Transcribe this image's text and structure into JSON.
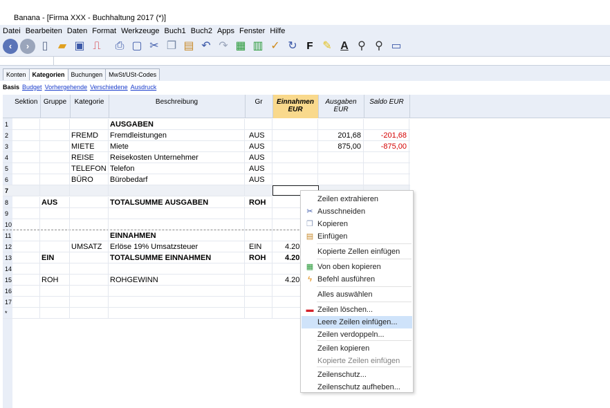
{
  "window": {
    "title": "Banana - [Firma XXX - Buchhaltung 2017 (*)]",
    "icon_text": "9"
  },
  "menu": [
    "Datei",
    "Bearbeiten",
    "Daten",
    "Format",
    "Werkzeuge",
    "Buch1",
    "Buch2",
    "Apps",
    "Fenster",
    "Hilfe"
  ],
  "toolbar": {
    "bold_label": "F"
  },
  "tabs": [
    {
      "label": "Konten",
      "active": false
    },
    {
      "label": "Kategorien",
      "active": true
    },
    {
      "label": "Buchungen",
      "active": false
    },
    {
      "label": "MwSt/USt-Codes",
      "active": false
    }
  ],
  "views": {
    "current": "Basis",
    "links": [
      "Budget",
      "Vorhergehende",
      "Verschiedene",
      "Ausdruck"
    ]
  },
  "columns": [
    "Sektion",
    "Gruppe",
    "Kategorie",
    "Beschreibung",
    "Gr",
    "Einnahmen EUR",
    "Ausgaben EUR",
    "Saldo EUR"
  ],
  "rows": [
    {
      "n": "1",
      "sektion": "",
      "gruppe": "",
      "kategorie": "",
      "beschreibung": "AUSGABEN",
      "gr": "",
      "einnahmen": "",
      "ausgaben": "",
      "saldo": "",
      "bold": true
    },
    {
      "n": "2",
      "sektion": "",
      "gruppe": "",
      "kategorie": "FREMD",
      "beschreibung": "Fremdleistungen",
      "gr": "AUS",
      "einnahmen": "",
      "ausgaben": "201,68",
      "saldo": "-201,68",
      "bold": false
    },
    {
      "n": "3",
      "sektion": "",
      "gruppe": "",
      "kategorie": "MIETE",
      "beschreibung": "Miete",
      "gr": "AUS",
      "einnahmen": "",
      "ausgaben": "875,00",
      "saldo": "-875,00",
      "bold": false
    },
    {
      "n": "4",
      "sektion": "",
      "gruppe": "",
      "kategorie": "REISE",
      "beschreibung": "Reisekosten Unternehmer",
      "gr": "AUS",
      "einnahmen": "",
      "ausgaben": "",
      "saldo": "",
      "bold": false
    },
    {
      "n": "5",
      "sektion": "",
      "gruppe": "",
      "kategorie": "TELEFON",
      "beschreibung": "Telefon",
      "gr": "AUS",
      "einnahmen": "",
      "ausgaben": "",
      "saldo": "",
      "bold": false
    },
    {
      "n": "6",
      "sektion": "",
      "gruppe": "",
      "kategorie": "BÜRO",
      "beschreibung": "Bürobedarf",
      "gr": "AUS",
      "einnahmen": "",
      "ausgaben": "",
      "saldo": "",
      "bold": false
    },
    {
      "n": "7",
      "sektion": "",
      "gruppe": "",
      "kategorie": "",
      "beschreibung": "",
      "gr": "",
      "einnahmen": "",
      "ausgaben": "",
      "saldo": "",
      "bold": false
    },
    {
      "n": "8",
      "sektion": "",
      "gruppe": "AUS",
      "kategorie": "",
      "beschreibung": "TOTALSUMME AUSGABEN",
      "gr": "ROH",
      "einnahmen": "",
      "ausgaben": "",
      "saldo": "",
      "bold": true
    },
    {
      "n": "9",
      "sektion": "",
      "gruppe": "",
      "kategorie": "",
      "beschreibung": "",
      "gr": "",
      "einnahmen": "",
      "ausgaben": "",
      "saldo": "",
      "bold": false
    },
    {
      "n": "10",
      "sektion": "",
      "gruppe": "",
      "kategorie": "",
      "beschreibung": "",
      "gr": "",
      "einnahmen": "",
      "ausgaben": "",
      "saldo": "",
      "bold": false
    },
    {
      "n": "11",
      "sektion": "",
      "gruppe": "",
      "kategorie": "",
      "beschreibung": "EINNAHMEN",
      "gr": "",
      "einnahmen": "",
      "ausgaben": "",
      "saldo": "",
      "bold": true
    },
    {
      "n": "12",
      "sektion": "",
      "gruppe": "",
      "kategorie": "UMSATZ",
      "beschreibung": "Erlöse 19% Umsatzsteuer",
      "gr": "EIN",
      "einnahmen": "4.20",
      "ausgaben": "",
      "saldo": "",
      "bold": false
    },
    {
      "n": "13",
      "sektion": "",
      "gruppe": "EIN",
      "kategorie": "",
      "beschreibung": "TOTALSUMME EINNAHMEN",
      "gr": "ROH",
      "einnahmen": "4.20",
      "ausgaben": "",
      "saldo": "",
      "bold": true
    },
    {
      "n": "14",
      "sektion": "",
      "gruppe": "",
      "kategorie": "",
      "beschreibung": "",
      "gr": "",
      "einnahmen": "",
      "ausgaben": "",
      "saldo": "",
      "bold": false
    },
    {
      "n": "15",
      "sektion": "",
      "gruppe": "ROH",
      "kategorie": "",
      "beschreibung": "ROHGEWINN",
      "gr": "",
      "einnahmen": "4.20",
      "ausgaben": "",
      "saldo": "",
      "bold": false
    },
    {
      "n": "16",
      "sektion": "",
      "gruppe": "",
      "kategorie": "",
      "beschreibung": "",
      "gr": "",
      "einnahmen": "",
      "ausgaben": "",
      "saldo": "",
      "bold": false
    },
    {
      "n": "17",
      "sektion": "",
      "gruppe": "",
      "kategorie": "",
      "beschreibung": "",
      "gr": "",
      "einnahmen": "",
      "ausgaben": "",
      "saldo": "",
      "bold": false
    },
    {
      "n": "*",
      "sektion": "",
      "gruppe": "",
      "kategorie": "",
      "beschreibung": "",
      "gr": "",
      "einnahmen": "",
      "ausgaben": "",
      "saldo": "",
      "bold": false
    }
  ],
  "context_menu": [
    {
      "label": "Zeilen extrahieren",
      "icon": "",
      "highlight": false,
      "disabled": false
    },
    {
      "label": "Ausschneiden",
      "icon": "scissors-icon",
      "highlight": false,
      "disabled": false
    },
    {
      "label": "Kopieren",
      "icon": "copy-icon",
      "highlight": false,
      "disabled": false
    },
    {
      "label": "Einfügen",
      "icon": "paste-icon",
      "highlight": false,
      "disabled": false
    },
    {
      "label": "Kopierte Zellen einfügen",
      "icon": "",
      "highlight": false,
      "disabled": false
    },
    {
      "label": "Von oben kopieren",
      "icon": "copy-from-above-icon",
      "highlight": false,
      "disabled": false
    },
    {
      "label": "Befehl ausführen",
      "icon": "lightning-icon",
      "highlight": false,
      "disabled": false
    },
    {
      "label": "Alles auswählen",
      "icon": "",
      "highlight": false,
      "disabled": false
    },
    {
      "label": "Zeilen löschen...",
      "icon": "delete-rows-icon",
      "highlight": false,
      "disabled": false
    },
    {
      "label": "Leere Zeilen einfügen...",
      "icon": "",
      "highlight": true,
      "disabled": false
    },
    {
      "label": "Zeilen verdoppeln...",
      "icon": "",
      "highlight": false,
      "disabled": false
    },
    {
      "label": "Zeilen kopieren",
      "icon": "",
      "highlight": false,
      "disabled": false
    },
    {
      "label": "Kopierte Zeilen  einfügen",
      "icon": "",
      "highlight": false,
      "disabled": true
    },
    {
      "label": "Zeilenschutz...",
      "icon": "",
      "highlight": false,
      "disabled": false
    },
    {
      "label": "Zeilenschutz aufheben...",
      "icon": "",
      "highlight": false,
      "disabled": false
    }
  ]
}
